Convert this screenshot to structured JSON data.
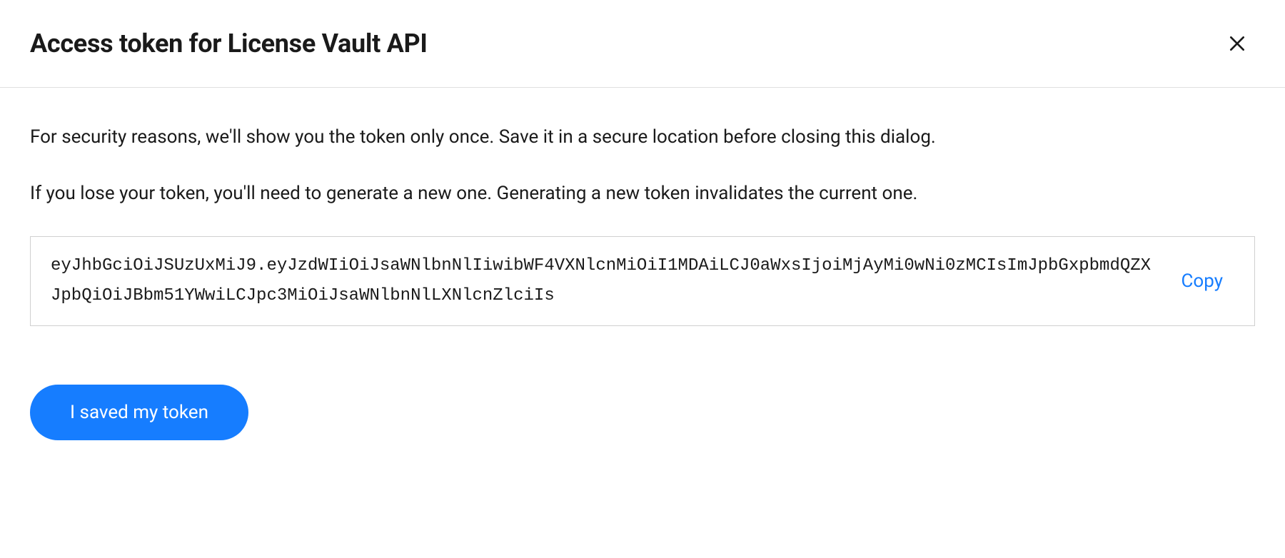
{
  "dialog": {
    "title": "Access token for License Vault API",
    "info_line_1": "For security reasons, we'll show you the token only once. Save it in a secure location before closing this dialog.",
    "info_line_2": "If you lose your token, you'll need to generate a new one. Generating a new token invalidates the current one.",
    "token_value": "eyJhbGciOiJSUzUxMiJ9.eyJzdWIiOiJsaWNlbnNlIiwibWF4VXNlcnMiOiI1MDAiLCJ0aWxsIjoiMjAyMi0wNi0zMCIsImJpbGxpbmdQZXJpbQiOiJBbm51YWwiLCJpc3MiOiJsaWNlbnNlLXNlcnZlciIs",
    "copy_label": "Copy",
    "confirm_button_label": "I saved my token"
  }
}
